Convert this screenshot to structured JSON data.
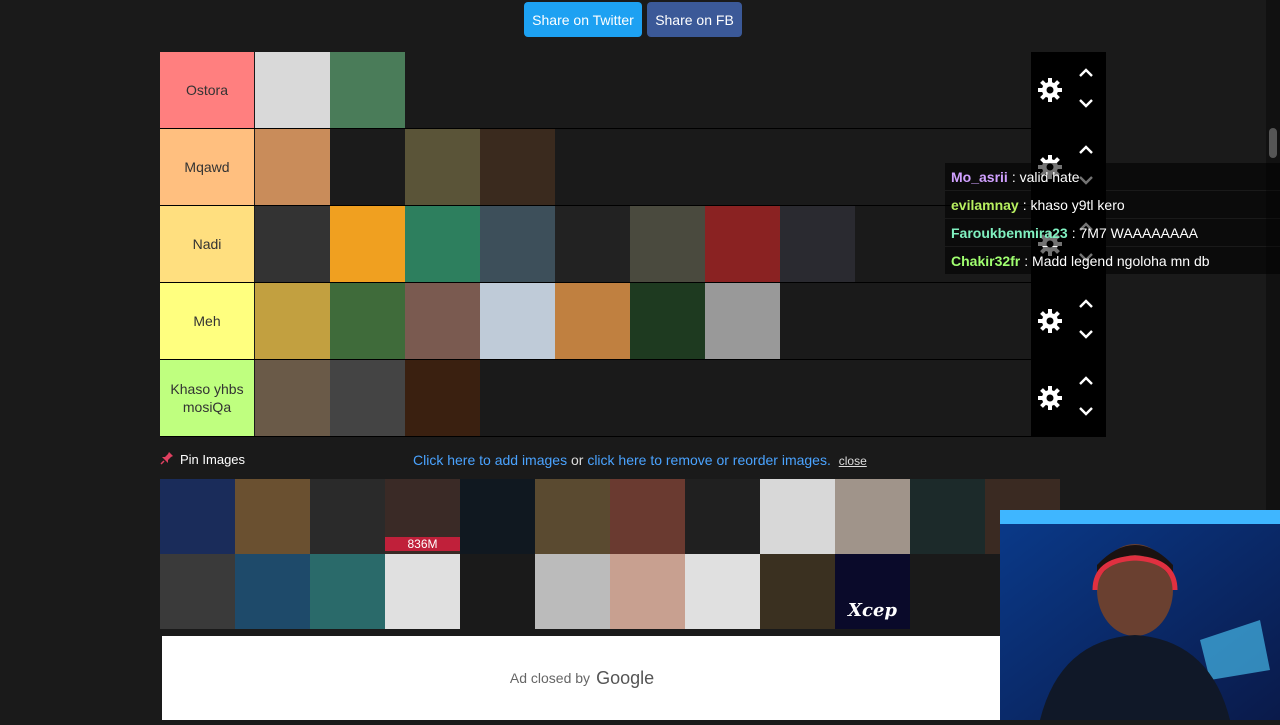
{
  "share": {
    "twitter_label": "Share on Twitter",
    "fb_label": "Share on FB"
  },
  "tiers": [
    {
      "label": "Ostora",
      "color": "#ff7f7f",
      "images": [
        "#d9d9d9",
        "#4a7c59"
      ]
    },
    {
      "label": "Mqawd",
      "color": "#ffbf7f",
      "images": [
        "#c98c5a",
        "#1b1b1b",
        "#5a5438",
        "#3a2a1e"
      ]
    },
    {
      "label": "Nadi",
      "color": "#ffdf7f",
      "images": [
        "#333333",
        "#f0a020",
        "#2d7f5e",
        "#3d4f5a",
        "#222222",
        "#4a4a3e",
        "#8a2222",
        "#2a2a30"
      ]
    },
    {
      "label": "Meh",
      "color": "#ffff7f",
      "images": [
        "#c2a040",
        "#3f6b3a",
        "#7a5a50",
        "#bfcbd8",
        "#c08040",
        "#1e3a20",
        "#999999"
      ]
    },
    {
      "label": "Khaso yhbs mosiQa",
      "color": "#bfff7f",
      "images": [
        "#6a5a48",
        "#444444",
        "#3a2010"
      ]
    }
  ],
  "icons": {
    "settings": "gear-icon",
    "move_up": "chevron-up-icon",
    "move_down": "chevron-down-icon",
    "pin": "pushpin-icon"
  },
  "chat": [
    {
      "user": "Mo_asrii",
      "color": "#d0a0ff",
      "message": ": valid hate"
    },
    {
      "user": "evilamnay",
      "color": "#b8f060",
      "message": ": khaso y9tl kero"
    },
    {
      "user": "Faroukbenmira23",
      "color": "#80f0c0",
      "message": ": 7M7 WAAAAAAAA"
    },
    {
      "user": "Chakir32fr",
      "color": "#a0ff70",
      "message": ": Madd legend ngoloha mn db"
    }
  ],
  "pin_images_label": "Pin Images",
  "links": {
    "add": "Click here to add images",
    "or": " or ",
    "remove": "click here to remove or reorder images.",
    "close": "close"
  },
  "pool": [
    [
      "#1a2c5a",
      "#6a5030",
      "#2a2a2a",
      "#3a2a26",
      "#101820",
      "#5a4a30",
      "#6a3a30",
      "#202020",
      "#d8d8d8",
      "#a0948a",
      "#1c2a2a",
      "#3a2a22"
    ],
    [
      "#3a3a3a",
      "#1e4a6a",
      "#2a6a6a",
      "#e0e0e0",
      "#1a1a1a",
      "#bbbbbb",
      "#c8a090",
      "#e0e0e0",
      "#3a3020",
      "#0a0a2a"
    ]
  ],
  "pool_captions": {
    "badge": "836M",
    "logo": "Xcep"
  },
  "ad": {
    "text": "Ad closed by",
    "brand": "Google"
  }
}
